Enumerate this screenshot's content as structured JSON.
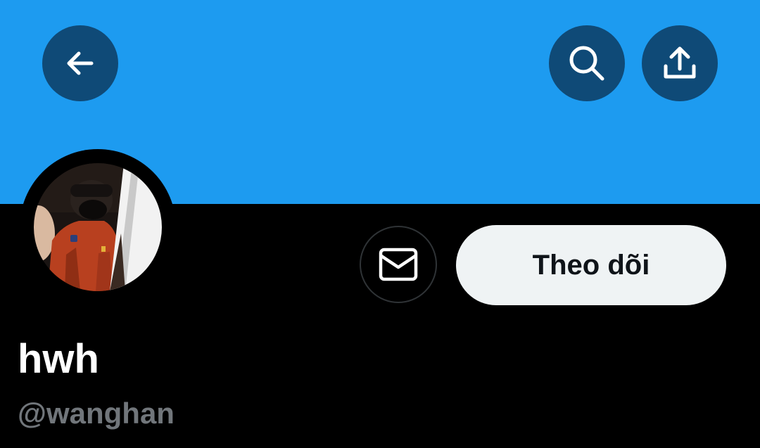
{
  "header": {
    "banner_color": "#1d9bf0",
    "back_icon": "arrow-left-icon",
    "search_icon": "search-icon",
    "share_icon": "share-icon"
  },
  "profile": {
    "display_name": "hwh",
    "handle": "@wanghan",
    "avatar": "profile-photo",
    "message_icon": "mail-icon",
    "follow_label": "Theo dõi"
  },
  "colors": {
    "background": "#000000",
    "header_button": "#0f4a77",
    "follow_button": "#eff3f4",
    "secondary_text": "#71767b"
  }
}
